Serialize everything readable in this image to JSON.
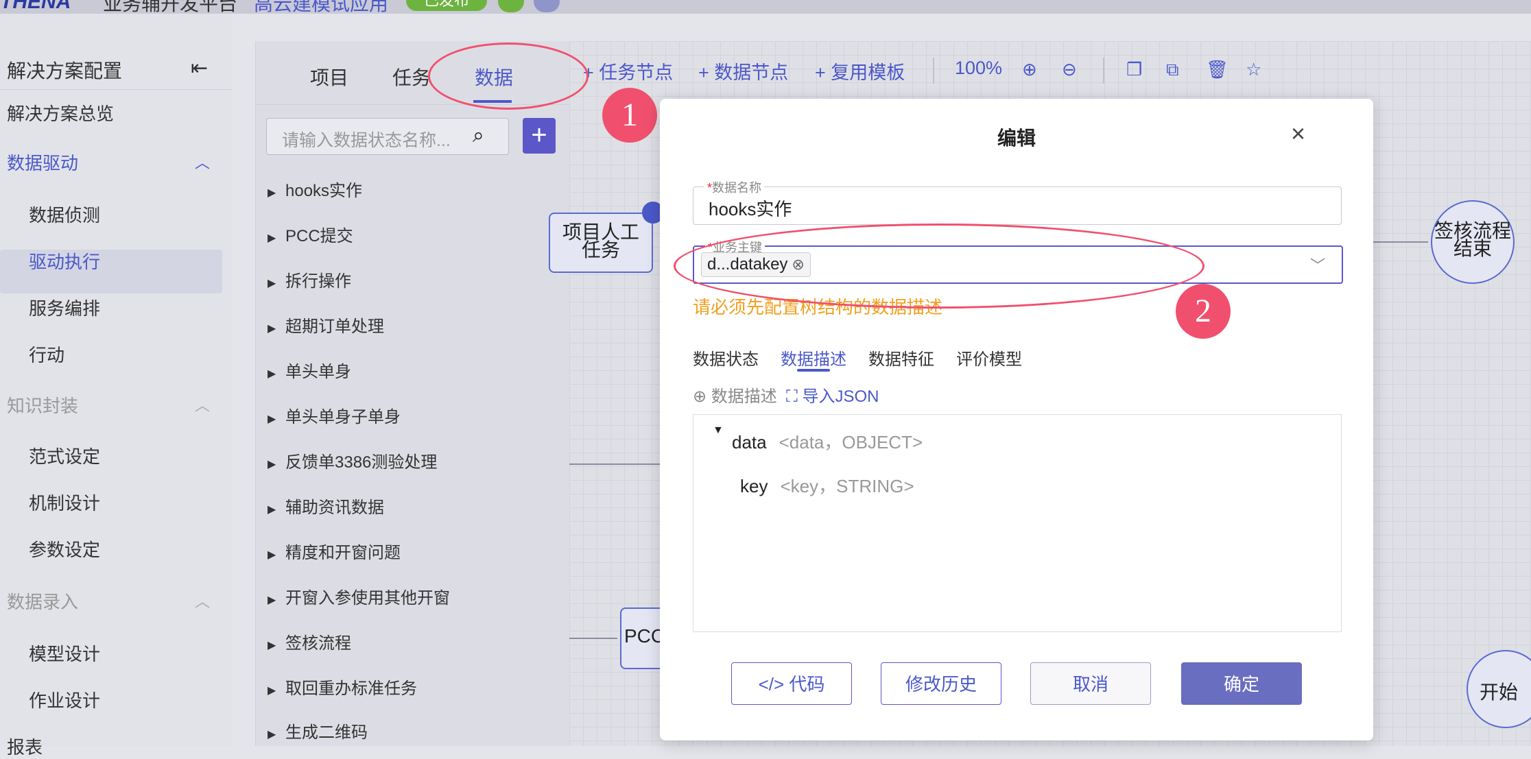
{
  "topbar": {
    "brand": "THENA",
    "title": "业务辅开发平台",
    "subtitle": "高云建模试应用",
    "status": "已发布"
  },
  "sidebar": {
    "title": "解决方案配置",
    "overview": "解决方案总览",
    "groups": [
      {
        "label": "数据驱动",
        "items": [
          "数据侦测",
          "驱动执行",
          "服务编排",
          "行动"
        ]
      },
      {
        "label": "知识封装",
        "items": [
          "范式设定",
          "机制设计",
          "参数设定"
        ]
      },
      {
        "label": "数据录入",
        "items": [
          "模型设计",
          "作业设计"
        ]
      }
    ],
    "last": "报表",
    "selected_item": "驱动执行"
  },
  "panel": {
    "tabs": [
      "项目",
      "任务",
      "数据"
    ],
    "active_tab": "数据",
    "search_placeholder": "请输入数据状态名称...",
    "add_label": "+",
    "tree": [
      "hooks实作",
      "PCC提交",
      "拆行操作",
      "超期订单处理",
      "单头单身",
      "单头单身子单身",
      "反馈单3386测验处理",
      "辅助资讯数据",
      "精度和开窗问题",
      "开窗入参使用其他开窗",
      "签核流程",
      "取回重办标准任务",
      "生成二维码"
    ]
  },
  "toolbar": {
    "task_node": "+ 任务节点",
    "data_node": "+ 数据节点",
    "reuse_template": "+ 复用模板",
    "zoom": "100%"
  },
  "canvas": {
    "node_project_task": "项目人工\n任务",
    "node_pcc": "PCC",
    "node_sign_end": "签核流程\n结束",
    "node_start": "开始"
  },
  "annotations": {
    "badge1": "1",
    "badge2": "2",
    "color": "#f0506e"
  },
  "dialog": {
    "title": "编辑",
    "close": "×",
    "name_label": "数据名称",
    "name_value": "hooks实作",
    "key_label": "业务主键",
    "key_tag": "d...datakey",
    "warning": "请必须先配置树结构的数据描述",
    "tabs": [
      "数据状态",
      "数据描述",
      "数据特征",
      "评价模型"
    ],
    "active_tab": "数据描述",
    "add_desc": "⊕ 数据描述",
    "import_json": "导入JSON",
    "tree": [
      {
        "name": "data",
        "type": "<data，OBJECT>"
      },
      {
        "name": "key",
        "type": "<key，STRING>"
      }
    ],
    "buttons": {
      "code": "代码",
      "history": "修改历史",
      "cancel": "取消",
      "ok": "确定"
    }
  },
  "colors": {
    "accent": "#4b58c9",
    "warning": "#f0a020",
    "primary_button": "#6a6ec0"
  }
}
